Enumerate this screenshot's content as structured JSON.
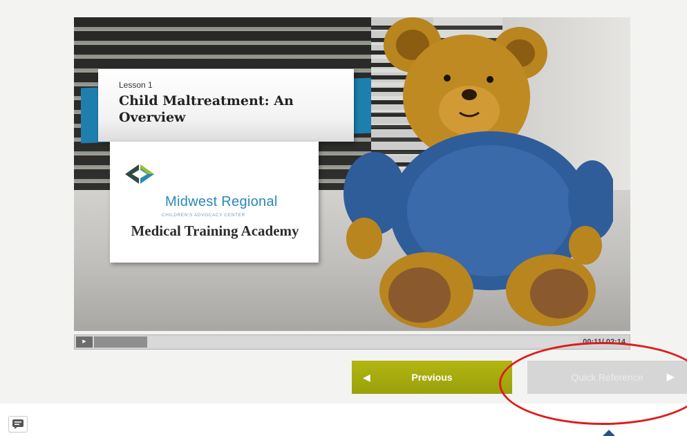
{
  "slide": {
    "lesson_label": "Lesson 1",
    "lesson_title": "Child Maltreatment: An Overview",
    "logo_name": "Midwest Regional",
    "logo_subtitle": "CHILDREN'S ADVOCACY CENTER",
    "academy": "Medical Training Academy"
  },
  "player": {
    "play_icon": "play-icon",
    "progress_fraction": 0.11,
    "time": "00:11/ 02:14"
  },
  "nav": {
    "previous_label": "Previous",
    "quick_reference_label": "Quick Reference",
    "previous_arrow": "◀",
    "next_arrow": "▶"
  },
  "colors": {
    "previous_button": "#a3a80d",
    "quick_reference_button_disabled": "#d6d6d6",
    "annotation_circle": "#e01b1b",
    "banner_blue": "#1e7fae",
    "logo_blue": "#2a89b6"
  },
  "icons": {
    "captions": "captions-icon"
  }
}
